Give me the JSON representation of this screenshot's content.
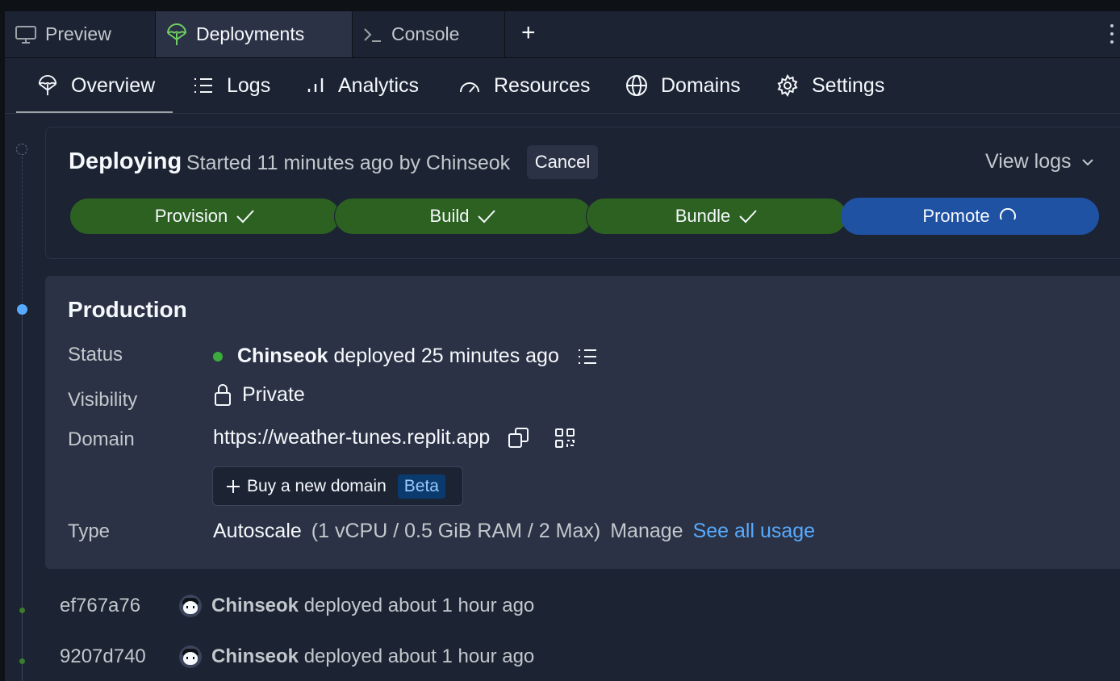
{
  "workspace_tabs": [
    {
      "label": "Preview",
      "icon": "monitor-icon"
    },
    {
      "label": "Deployments",
      "icon": "deployments-icon",
      "active": true
    },
    {
      "label": "Console",
      "icon": "terminal-icon"
    }
  ],
  "add_tab_glyph": "+",
  "subnav": [
    {
      "label": "Overview",
      "icon": "deployments-icon",
      "active": true
    },
    {
      "label": "Logs",
      "icon": "list-icon"
    },
    {
      "label": "Analytics",
      "icon": "bar-chart-icon"
    },
    {
      "label": "Resources",
      "icon": "gauge-icon"
    },
    {
      "label": "Domains",
      "icon": "globe-icon"
    },
    {
      "label": "Settings",
      "icon": "gear-icon"
    }
  ],
  "deploying": {
    "title": "Deploying",
    "subtitle": "Started 11 minutes ago by Chinseok",
    "cancel_label": "Cancel",
    "view_logs_label": "View logs",
    "steps": [
      {
        "label": "Provision",
        "state": "done"
      },
      {
        "label": "Build",
        "state": "done"
      },
      {
        "label": "Bundle",
        "state": "done"
      },
      {
        "label": "Promote",
        "state": "in-progress"
      }
    ]
  },
  "production": {
    "title": "Production",
    "status_label": "Status",
    "status_user": "Chinseok",
    "status_text": "deployed 25 minutes ago",
    "visibility_label": "Visibility",
    "visibility_value": "Private",
    "domain_label": "Domain",
    "domain_value": "https://weather-tunes.replit.app",
    "buy_domain_label": "Buy a new domain",
    "beta_badge": "Beta",
    "type_label": "Type",
    "type_value": "Autoscale",
    "type_specs": "(1 vCPU / 0.5 GiB RAM / 2 Max)",
    "manage_label": "Manage",
    "see_usage_label": "See all usage"
  },
  "history": [
    {
      "hash": "ef767a76",
      "user": "Chinseok",
      "text": "deployed about 1 hour ago"
    },
    {
      "hash": "9207d740",
      "user": "Chinseok",
      "text": "deployed about 1 hour ago"
    }
  ],
  "colors": {
    "background": "#1c2333",
    "surface": "#2b3245",
    "success": "#2c6121",
    "progress": "#1f52a3",
    "link": "#57abff",
    "status_dot": "#3dab3b"
  }
}
